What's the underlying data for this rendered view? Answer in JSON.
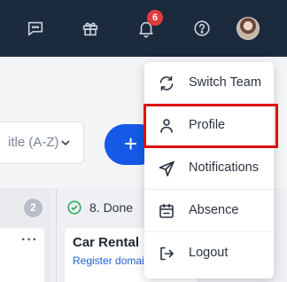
{
  "header": {
    "notifications_count": "6",
    "icons": [
      "chat-icon",
      "gift-icon",
      "bell-icon",
      "help-icon",
      "avatar"
    ]
  },
  "toolbar": {
    "sort_label": "itle (A-Z)",
    "add_label": "+"
  },
  "board": {
    "left_column_count": "2",
    "done_column_title": "8. Done",
    "card": {
      "title": "Car Rental",
      "link": "Register domai"
    }
  },
  "menu": {
    "items": [
      {
        "label": "Switch Team",
        "icon": "switch-icon"
      },
      {
        "label": "Profile",
        "icon": "person-icon"
      },
      {
        "label": "Notifications",
        "icon": "send-icon"
      },
      {
        "label": "Absence",
        "icon": "calendar-icon"
      },
      {
        "label": "Logout",
        "icon": "logout-icon"
      }
    ],
    "highlighted_item": "Profile"
  },
  "colors": {
    "topbar": "#1c2a3d",
    "badge": "#e23b3b",
    "primary": "#1659e6",
    "highlight": "#e01010",
    "done_check": "#2fae5a"
  }
}
